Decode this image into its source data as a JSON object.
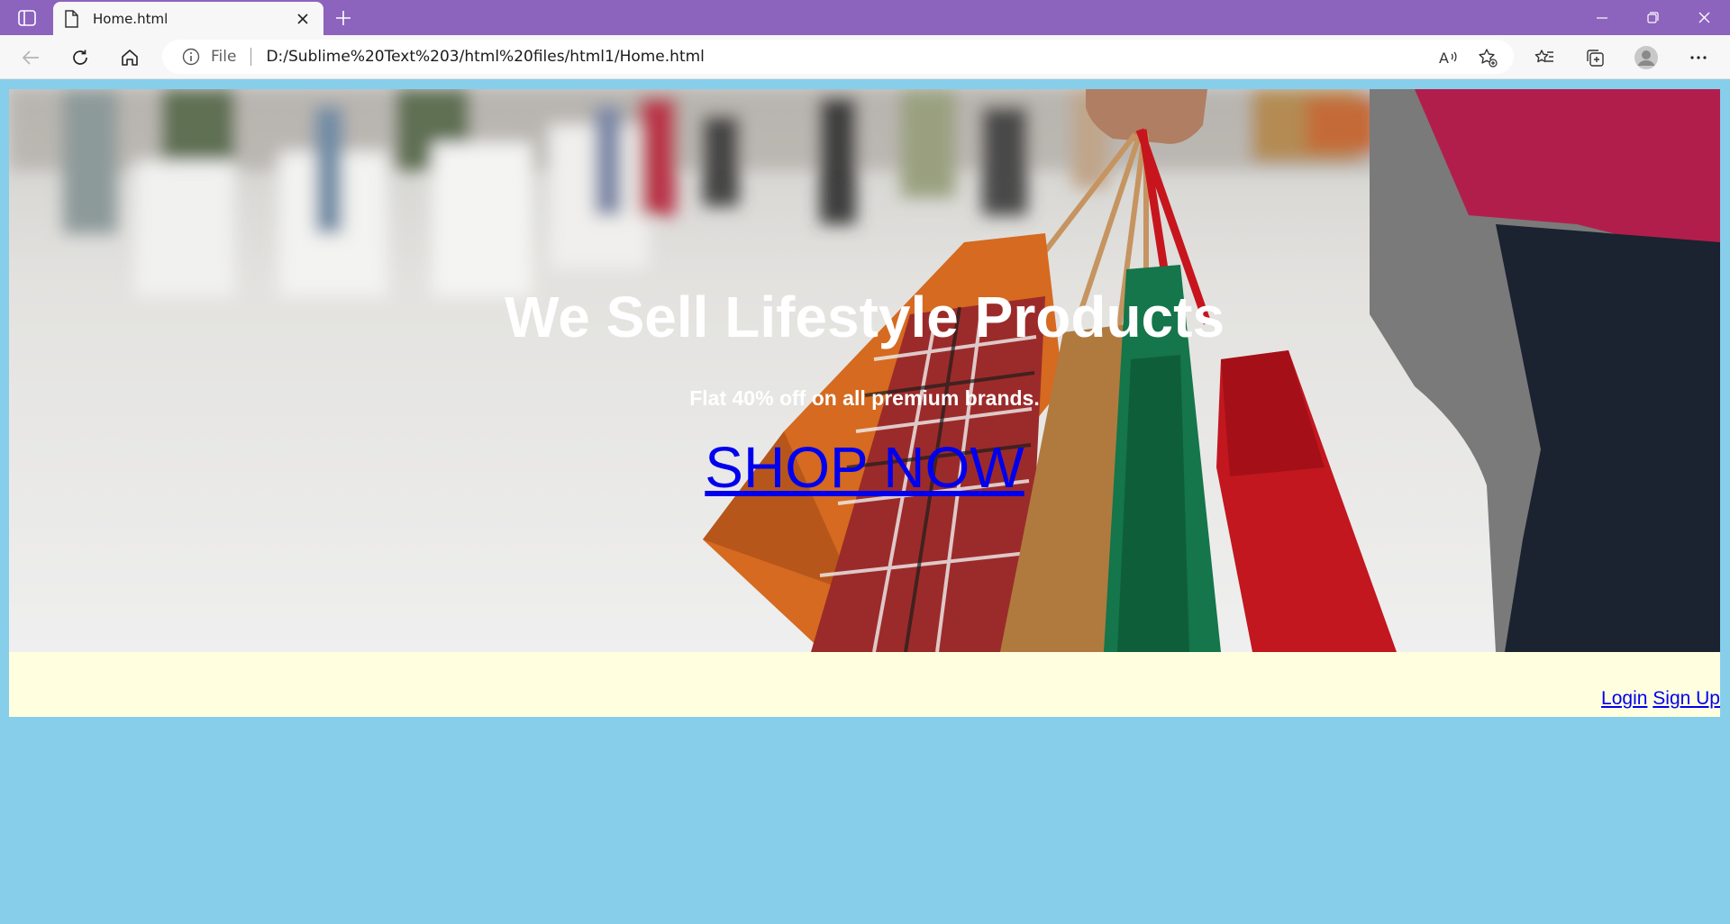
{
  "browser": {
    "tab_title": "Home.html",
    "url_scheme_label": "File",
    "url": "D:/Sublime%20Text%203/html%20files/html1/Home.html",
    "icons": [
      "tab-actions-icon",
      "document-icon",
      "close-icon",
      "plus-icon",
      "minimize-icon",
      "restore-icon",
      "window-close-icon",
      "back-icon",
      "refresh-icon",
      "home-icon",
      "info-icon",
      "read-aloud-icon",
      "add-favorite-icon",
      "favorites-icon",
      "collections-icon",
      "profile-icon",
      "more-icon"
    ],
    "colors": {
      "tabbar": "#8c63bd",
      "toolbar": "#f7f7f7"
    }
  },
  "hero": {
    "title": "We Sell Lifestyle Products",
    "subtitle": "Flat 40% off on all premium brands.",
    "cta_label": "SHOP NOW"
  },
  "footer": {
    "login_label": "Login",
    "signup_label": "Sign Up"
  },
  "colors": {
    "page_background": "#87ceeb",
    "footer_background": "#ffffe0",
    "link": "#0000ee",
    "hero_text": "#ffffff"
  }
}
